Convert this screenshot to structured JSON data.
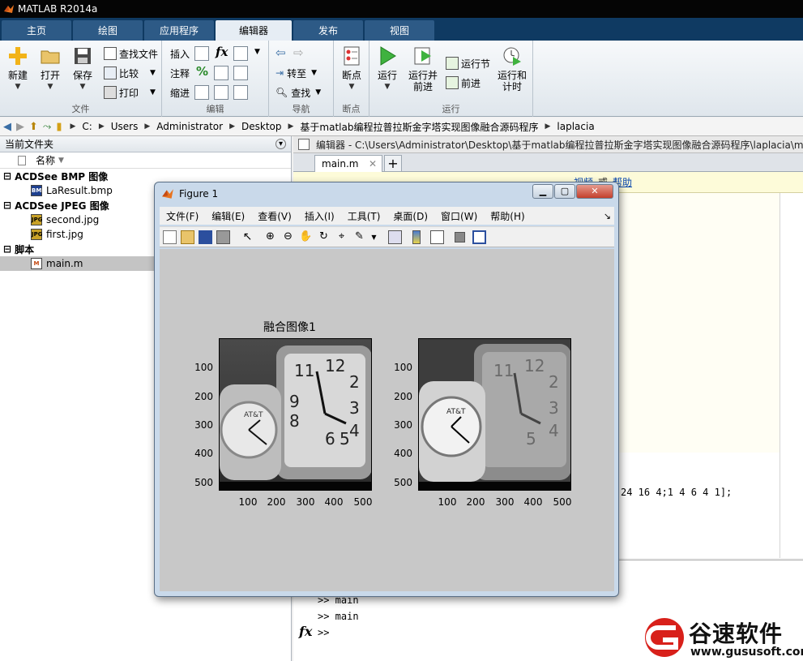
{
  "app": {
    "title": "MATLAB R2014a"
  },
  "tabs": [
    {
      "label": "主页"
    },
    {
      "label": "绘图"
    },
    {
      "label": "应用程序"
    },
    {
      "label": "编辑器"
    },
    {
      "label": "发布"
    },
    {
      "label": "视图"
    }
  ],
  "ribbon": {
    "file": {
      "label": "文件",
      "new": "新建",
      "open": "打开",
      "save": "保存",
      "find_files": "查找文件",
      "compare": "比较",
      "print": "打印"
    },
    "edit": {
      "label": "编辑",
      "insert": "插入",
      "comment": "注释",
      "indent": "缩进"
    },
    "navigate": {
      "label": "导航",
      "goto": "转至",
      "find": "查找"
    },
    "breakpoints": {
      "label": "断点",
      "breakpoints": "断点"
    },
    "run": {
      "label": "运行",
      "run": "运行",
      "run_advance_1": "运行并",
      "run_advance_2": "前进",
      "run_section": "运行节",
      "advance": "前进",
      "run_time_1": "运行和",
      "run_time_2": "计时"
    }
  },
  "address": {
    "crumbs": [
      "C:",
      "Users",
      "Administrator",
      "Desktop",
      "基于matlab编程拉普拉斯金字塔实现图像融合源码程序",
      "laplacia"
    ]
  },
  "left_panel": {
    "title": "当前文件夹",
    "column": "名称",
    "groups": [
      {
        "name": "ACDSee BMP 图像",
        "files": [
          {
            "name": "LaResult.bmp",
            "icon": "BMP"
          }
        ]
      },
      {
        "name": "ACDSee JPEG 图像",
        "files": [
          {
            "name": "second.jpg",
            "icon": "JPG"
          },
          {
            "name": "first.jpg",
            "icon": "JPG"
          }
        ]
      },
      {
        "name": "脚本",
        "files": [
          {
            "name": "main.m",
            "icon": "M"
          }
        ]
      }
    ]
  },
  "editor": {
    "title": "编辑器 - C:\\Users\\Administrator\\Desktop\\基于matlab编程拉普拉斯金字塔实现图像融合源码程序\\laplacia\\ma",
    "tab": "main.m",
    "info_link1": "视频",
    "info_or": "或",
    "info_link2": "帮助",
    "code_fragment": "24 16 4;1 4 6 4 1];"
  },
  "command_window": {
    "lines": [
      ">> main",
      ">> main"
    ],
    "prompt": ">>"
  },
  "figure": {
    "title": "Figure 1",
    "menus": [
      "文件(F)",
      "编辑(E)",
      "查看(V)",
      "插入(I)",
      "工具(T)",
      "桌面(D)",
      "窗口(W)",
      "帮助(H)"
    ],
    "axes_title": "融合图像1",
    "yticks": [
      "100",
      "200",
      "300",
      "400",
      "500"
    ],
    "xticks": [
      "100",
      "200",
      "300",
      "400",
      "500"
    ]
  },
  "watermark": {
    "brand": "谷速软件",
    "url": "www.gususoft.com"
  }
}
